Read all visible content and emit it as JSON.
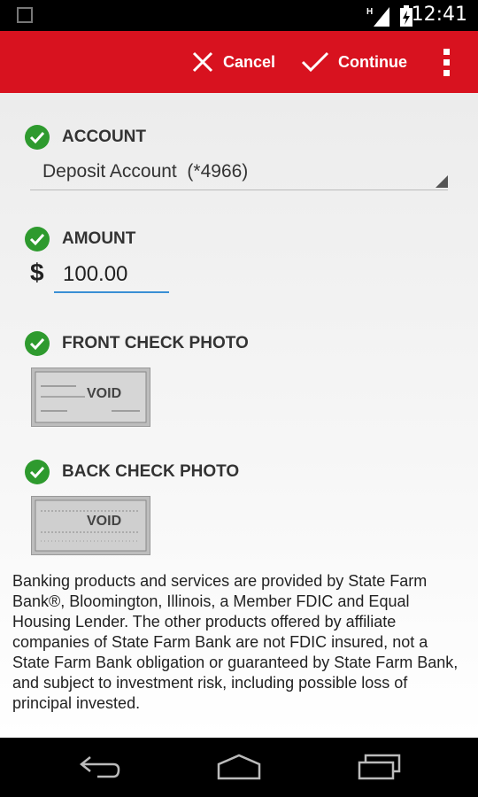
{
  "status_bar": {
    "time": "12:41",
    "network_label": "H"
  },
  "action_bar": {
    "cancel_label": "Cancel",
    "continue_label": "Continue"
  },
  "form": {
    "account": {
      "label": "ACCOUNT",
      "selected_value": "Deposit Account  (*4966)"
    },
    "amount": {
      "label": "AMOUNT",
      "currency_symbol": "$",
      "value": "100.00"
    },
    "front_photo": {
      "label": "FRONT CHECK PHOTO",
      "stamp_text": "VOID"
    },
    "back_photo": {
      "label": "BACK CHECK PHOTO",
      "stamp_text": "VOID"
    }
  },
  "disclaimer": "Banking products and services are provided by State Farm Bank®, Bloomington, Illinois, a Member FDIC and Equal Housing Lender. The other products offered by affiliate companies of State Farm Bank are not FDIC insured, not a State Farm Bank obligation or guaranteed by State Farm Bank, and subject to investment risk, including possible loss of principal invested.",
  "colors": {
    "brand_red": "#d8121f",
    "check_green": "#2e9a2e",
    "input_underline": "#3a8fd4"
  },
  "icons": [
    "x-icon",
    "checkmark-icon",
    "overflow-menu-icon",
    "check-circle-icon",
    "back-icon",
    "home-icon",
    "recent-apps-icon"
  ]
}
